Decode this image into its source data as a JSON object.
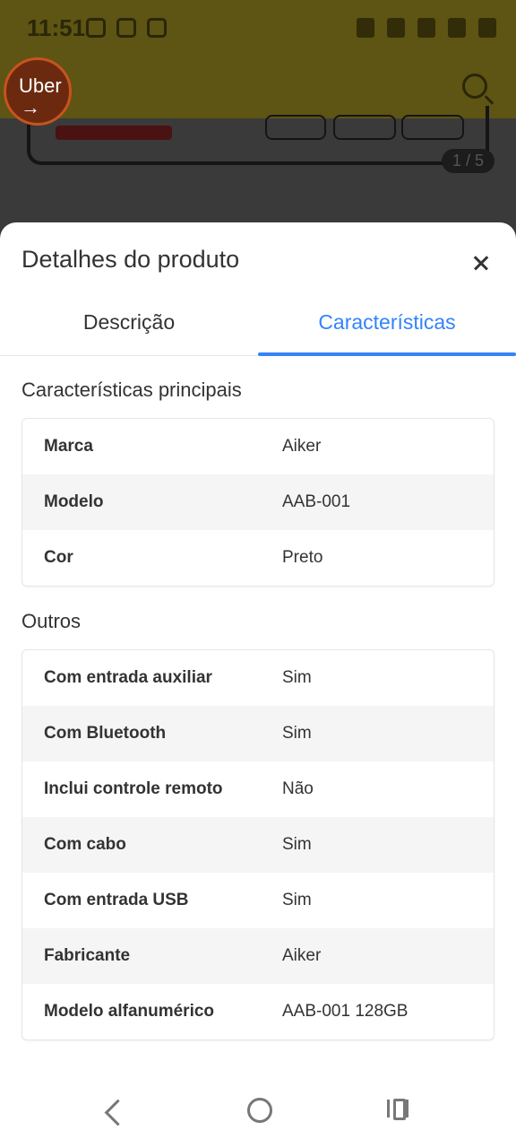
{
  "status_bar": {
    "time": "11:51"
  },
  "background_app": {
    "overlay_badge": {
      "line1": "Uber",
      "arrow": "→"
    },
    "image_pager": "1 / 5"
  },
  "sheet": {
    "title": "Detalhes do produto",
    "tabs": [
      {
        "label": "Descrição",
        "active": false
      },
      {
        "label": "Características",
        "active": true
      }
    ],
    "main_section": {
      "title": "Características principais",
      "rows": [
        {
          "label": "Marca",
          "value": "Aiker"
        },
        {
          "label": "Modelo",
          "value": "AAB-001"
        },
        {
          "label": "Cor",
          "value": "Preto"
        }
      ]
    },
    "other_section": {
      "title": "Outros",
      "rows": [
        {
          "label": "Com entrada auxiliar",
          "value": "Sim"
        },
        {
          "label": "Com Bluetooth",
          "value": "Sim"
        },
        {
          "label": "Inclui controle remoto",
          "value": "Não"
        },
        {
          "label": "Com cabo",
          "value": "Sim"
        },
        {
          "label": "Com entrada USB",
          "value": "Sim"
        },
        {
          "label": "Fabricante",
          "value": "Aiker"
        },
        {
          "label": "Modelo alfanumérico",
          "value": "AAB-001 128GB"
        }
      ]
    }
  },
  "colors": {
    "accent": "#3483fa",
    "text": "#333333",
    "row_alt": "#f5f5f5"
  }
}
